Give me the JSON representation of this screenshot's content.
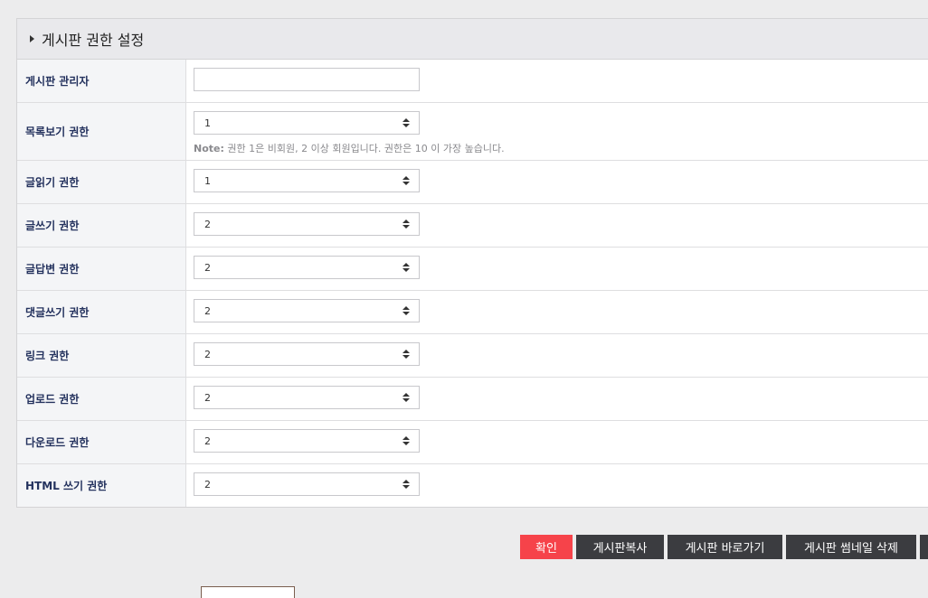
{
  "panel": {
    "title": "게시판 권한 설정"
  },
  "rows": [
    {
      "label": "게시판 관리자",
      "type": "text",
      "value": ""
    },
    {
      "label": "목록보기 권한",
      "type": "select",
      "value": "1",
      "note_prefix": "Note:",
      "note": " 권한 1은 비회원, 2 이상 회원입니다. 권한은 10 이 가장 높습니다."
    },
    {
      "label": "글읽기 권한",
      "type": "select",
      "value": "1"
    },
    {
      "label": "글쓰기 권한",
      "type": "select",
      "value": "2"
    },
    {
      "label": "글답변 권한",
      "type": "select",
      "value": "2"
    },
    {
      "label": "댓글쓰기 권한",
      "type": "select",
      "value": "2"
    },
    {
      "label": "링크 권한",
      "type": "select",
      "value": "2"
    },
    {
      "label": "업로드 권한",
      "type": "select",
      "value": "2"
    },
    {
      "label": "다운로드 권한",
      "type": "select",
      "value": "2"
    },
    {
      "label": "HTML 쓰기 권한",
      "type": "select",
      "value": "2"
    }
  ],
  "buttons": {
    "confirm": "확인",
    "copy": "게시판복사",
    "goto": "게시판 바로가기",
    "thumb_delete": "게시판 썸네일 삭제"
  },
  "colors": {
    "primary": "#f6434a",
    "dark_button": "#3b3c40",
    "label_text": "#24325e"
  }
}
